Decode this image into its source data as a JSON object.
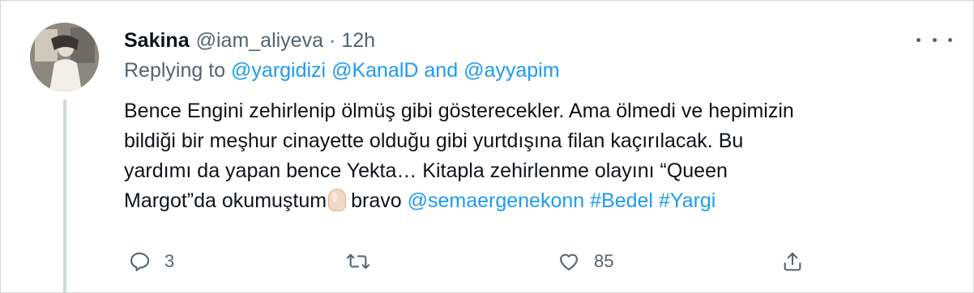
{
  "tweet": {
    "author": {
      "display_name": "Sakina",
      "handle": "@iam_aliyeva",
      "separator": "·",
      "time": "12h"
    },
    "replying": {
      "prefix": "Replying to",
      "mentions": [
        "@yargidizi",
        "@KanalD"
      ],
      "conjunction": "and",
      "last_mention": "@ayyapim"
    },
    "text": {
      "line1": "Bence Engini zehirlenip ölmüş gibi gösterecekler. Ama ölmedi ve hepimizin",
      "line2": "bildiği bir meşhur cinayette olduğu gibi yurtdışına filan kaçırılacak. Bu",
      "line3": "yardımı da yapan bence Yekta… Kitapla zehirlenme olayını “Queen",
      "line4_pre": "Margot”da okumuştum",
      "line4_emoji": "pinching-hand-emoji",
      "line4_post": "bravo",
      "mention": "@semaergenekonn",
      "hashtags": [
        "#Bedel",
        "#Yargi"
      ]
    },
    "actions": {
      "reply_count": "3",
      "retweet_count": "",
      "like_count": "85"
    },
    "icons": [
      "more-icon",
      "reply-icon",
      "retweet-icon",
      "like-icon",
      "share-icon"
    ],
    "colors": {
      "link": "#1d9bf0",
      "secondary": "#536471",
      "text": "#0f1419",
      "thread_line": "#cfd9de"
    }
  }
}
